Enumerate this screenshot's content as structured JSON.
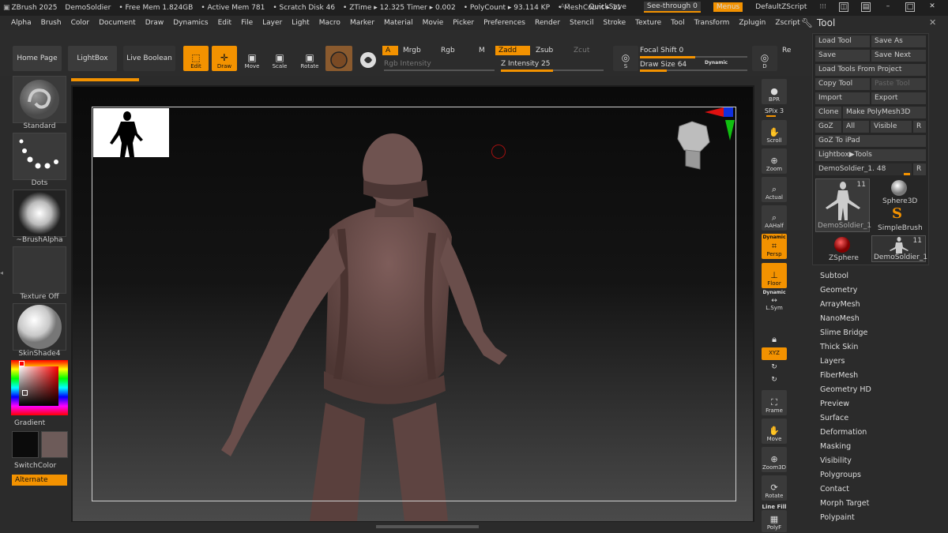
{
  "titlebar": {
    "app": "ZBrush 2025",
    "project": "DemoSoldier",
    "free_mem": "• Free Mem 1.824GB",
    "active_mem": "• Active Mem 781",
    "scratch": "• Scratch Disk 46",
    "ztime": "• ZTime ▸ 12.325 Timer ▸ 0.002",
    "polycount": "• PolyCount ▸ 93.114 KP",
    "meshcount": "• MeshCount ▸ 11",
    "ac": "AC",
    "quicksave": "QuickSave",
    "seethrough": "See-through  0",
    "menus": "Menus",
    "zscript": "DefaultZScript"
  },
  "menubar": [
    "Alpha",
    "Brush",
    "Color",
    "Document",
    "Draw",
    "Dynamics",
    "Edit",
    "File",
    "Layer",
    "Light",
    "Macro",
    "Marker",
    "Material",
    "Movie",
    "Picker",
    "Preferences",
    "Render",
    "Stencil",
    "Stroke",
    "Texture",
    "Tool",
    "Transform",
    "Zplugin",
    "Zscript"
  ],
  "shelf": {
    "home": "Home Page",
    "lightbox": "LightBox",
    "liveboolean": "Live Boolean",
    "edit": "Edit",
    "draw": "Draw",
    "move": "Move",
    "scale": "Scale",
    "rotate": "Rotate",
    "a": "A",
    "mrgb": "Mrgb",
    "rgb": "Rgb",
    "m": "M",
    "zadd": "Zadd",
    "zsub": "Zsub",
    "zcut": "Zcut",
    "rgb_intensity": "Rgb Intensity",
    "z_intensity": "Z Intensity 25",
    "focal_shift": "Focal Shift 0",
    "draw_size": "Draw Size 64",
    "dynamic": "Dynamic",
    "s": "S",
    "d": "D",
    "re": "Re"
  },
  "leftpanel": {
    "standard": "Standard",
    "dots": "Dots",
    "brushalpha": "~BrushAlpha",
    "texture": "Texture Off",
    "material": "SkinShade4",
    "gradient": "Gradient",
    "switchcolor": "SwitchColor",
    "alternate": "Alternate"
  },
  "rightbar": {
    "bpr": "BPR",
    "spix": "SPix 3",
    "scroll": "Scroll",
    "zoom": "Zoom",
    "actual": "Actual",
    "aahalf": "AAHalf",
    "dynamic": "Dynamic",
    "persp": "Persp",
    "floor": "Floor",
    "dynamic2": "Dynamic",
    "lsym": "L.Sym",
    "xyz": "XYZ",
    "frame": "Frame",
    "move": "Move",
    "zoom3d": "Zoom3D",
    "rotate": "Rotate",
    "linefill": "Line Fill",
    "polyf": "PolyF"
  },
  "toolpanel": {
    "title": "Tool",
    "load_tool": "Load Tool",
    "save_as": "Save As",
    "save": "Save",
    "save_next": "Save Next",
    "load_from_project": "Load Tools From Project",
    "copy_tool": "Copy Tool",
    "paste_tool": "Paste Tool",
    "import": "Import",
    "export": "Export",
    "clone": "Clone",
    "make_polymesh": "Make PolyMesh3D",
    "goz": "GoZ",
    "all": "All",
    "visible": "Visible",
    "r": "R",
    "goz_ipad": "GoZ To iPad",
    "lightbox_tools": "Lightbox▶Tools",
    "current_tool": "DemoSoldier_1. 48",
    "thumbs": [
      {
        "label": "DemoSoldier_1",
        "count": "11"
      },
      {
        "label": "Sphere3D",
        "count": ""
      },
      {
        "label": "SimpleBrush",
        "count": ""
      },
      {
        "label": "ZSphere",
        "count": ""
      },
      {
        "label": "DemoSoldier_1",
        "count": "11"
      }
    ],
    "menus": [
      "Subtool",
      "Geometry",
      "ArrayMesh",
      "NanoMesh",
      "Slime Bridge",
      "Thick Skin",
      "Layers",
      "FiberMesh",
      "Geometry HD",
      "Preview",
      "Surface",
      "Deformation",
      "Masking",
      "Visibility",
      "Polygroups",
      "Contact",
      "Morph Target",
      "Polypaint"
    ]
  },
  "colors": {
    "accent": "#f39200",
    "model": "#6e5250",
    "primary_color": "#0b0b0b",
    "secondary_color": "#6d5b59"
  }
}
